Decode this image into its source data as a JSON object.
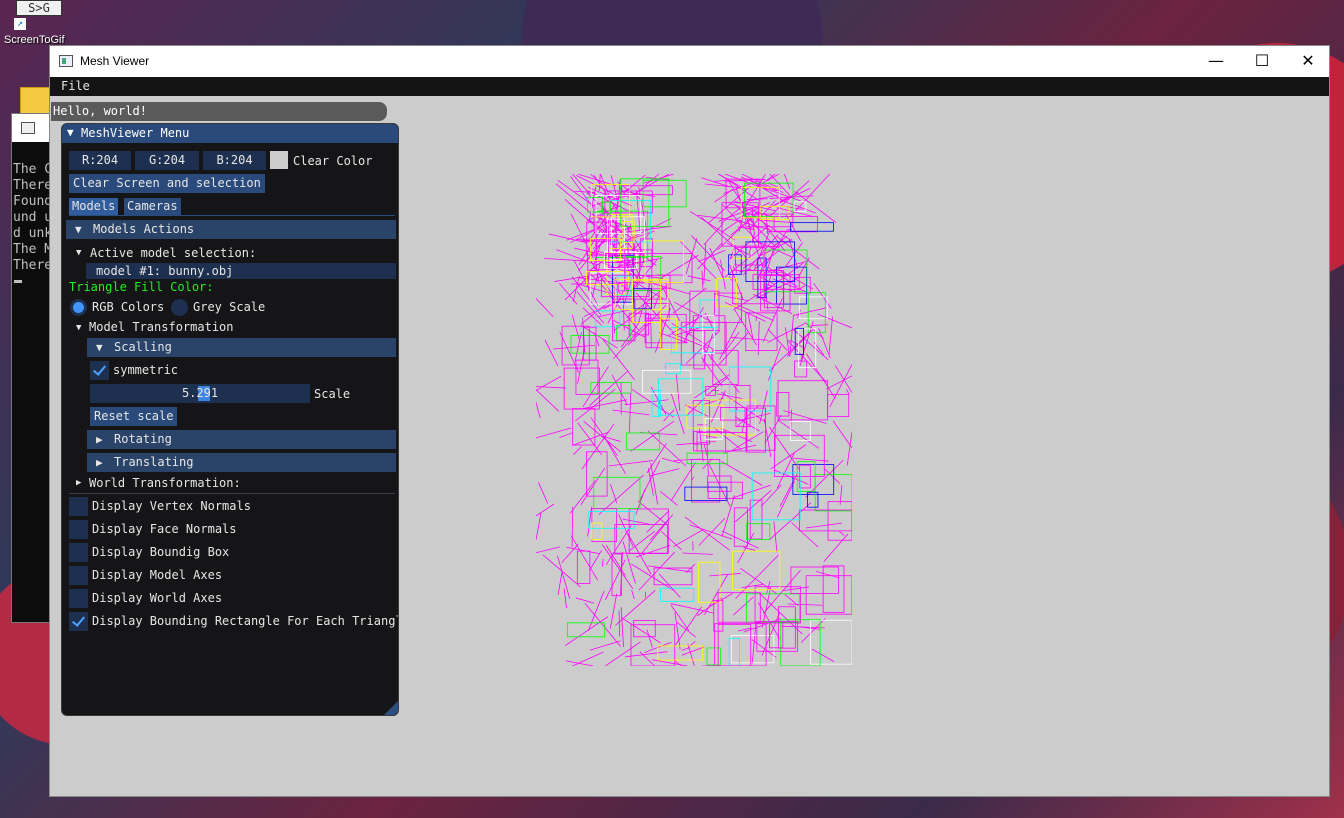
{
  "desktop": {
    "icon_glyph": "S>G",
    "icon_label": "ScreenToGif",
    "console_lines": [
      "The C",
      "There",
      "Found",
      "und u",
      "d unk",
      "The M",
      "There"
    ]
  },
  "window": {
    "title": "Mesh Viewer",
    "minimize": "—",
    "maximize": "☐",
    "close": "✕"
  },
  "menubar": {
    "file": "File"
  },
  "hello_window": {
    "title": "Hello, world!"
  },
  "menu": {
    "title": "MeshViewer Menu",
    "clear_color": {
      "r": "R:204",
      "g": "G:204",
      "b": "B:204",
      "label": "Clear Color",
      "swatch": "#cccccc"
    },
    "clear_button": "Clear Screen and selection",
    "tabs": [
      "Models",
      "Cameras"
    ],
    "models_actions": "Models Actions",
    "active_model_label": "Active model selection:",
    "active_model_value": "model #1: bunny.obj",
    "fill_color_label": "Triangle Fill Color:",
    "fill_options": [
      "RGB Colors",
      "Grey Scale"
    ],
    "fill_selected": "RGB Colors",
    "model_transformation": "Model Transformation",
    "scaling": "Scalling",
    "symmetric": "symmetric",
    "scale_value": "5.291",
    "scale_value_fraction": 0.46,
    "scale_label": "Scale",
    "reset_scale": "Reset scale",
    "rotating": "Rotating",
    "translating": "Translating",
    "world_transformation": "World Transformation:",
    "display_options": [
      {
        "label": "Display Vertex Normals",
        "checked": false
      },
      {
        "label": "Display Face Normals",
        "checked": false
      },
      {
        "label": "Display Boundig Box",
        "checked": false
      },
      {
        "label": "Display Model Axes",
        "checked": false
      },
      {
        "label": "Display World Axes",
        "checked": false
      },
      {
        "label": "Display Bounding Rectangle For Each Triangle",
        "checked": true
      }
    ]
  },
  "colors": {
    "accent": "#294a7a",
    "mesh_primary": "#ff00ff",
    "mesh_secondary": [
      "#00ffff",
      "#ffff00",
      "#0000ff",
      "#ffffff",
      "#00ff00"
    ]
  }
}
